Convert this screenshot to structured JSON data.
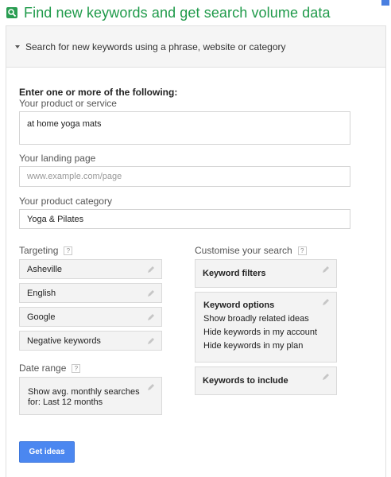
{
  "page": {
    "title": "Find new keywords and get search volume data"
  },
  "panel": {
    "header": "Search for new keywords using a phrase, website or category",
    "intro": "Enter one or more of the following:",
    "product_service": {
      "label": "Your product or service",
      "value": "at home yoga mats"
    },
    "landing_page": {
      "label": "Your landing page",
      "placeholder": "www.example.com/page"
    },
    "product_category": {
      "label": "Your product category",
      "value": "Yoga & Pilates"
    },
    "targeting": {
      "label": "Targeting",
      "help": "?",
      "items": [
        "Asheville",
        "English",
        "Google",
        "Negative keywords"
      ]
    },
    "date_range": {
      "label": "Date range",
      "help": "?",
      "line1": "Show avg. monthly searches",
      "line2": "for: Last 12 months"
    },
    "customise": {
      "label": "Customise your search",
      "help": "?",
      "keyword_filters": "Keyword filters",
      "keyword_options": {
        "title": "Keyword options",
        "lines": [
          "Show broadly related ideas",
          "Hide keywords in my account",
          "Hide keywords in my plan"
        ]
      },
      "keywords_to_include": "Keywords to include"
    },
    "get_ideas": "Get ideas"
  },
  "colors": {
    "title_green": "#1f9a4a",
    "button_blue": "#4b87f0"
  },
  "icons": {
    "title": "search-icon",
    "edit": "pencil-icon",
    "expand": "caret-down-icon"
  }
}
